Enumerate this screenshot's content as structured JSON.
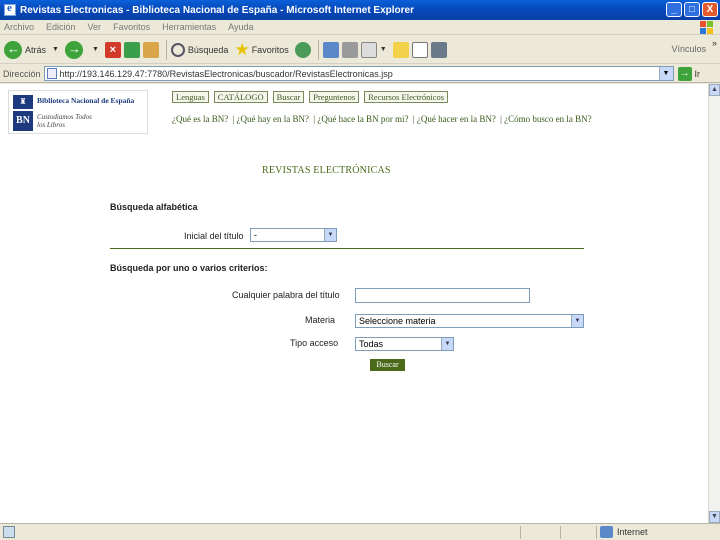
{
  "window": {
    "title": "Revistas Electronicas - Biblioteca Nacional de España - Microsoft Internet Explorer",
    "minimize": "_",
    "maximize": "□",
    "close": "X"
  },
  "menu": [
    "Archivo",
    "Edición",
    "Ver",
    "Favoritos",
    "Herramientas",
    "Ayuda"
  ],
  "toolbar": {
    "back": "Atrás",
    "search": "Búsqueda",
    "favorites": "Favoritos",
    "links": "Vínculos"
  },
  "address": {
    "label": "Dirección",
    "url": "http://193.146.129.47:7780/RevistasElectronicas/buscador/RevistasElectronicas.jsp",
    "go": "Ir"
  },
  "logo": {
    "name": "Biblioteca Nacional de España",
    "abbr": "BN",
    "tagline_1": "Custodiamos Todos",
    "tagline_2": "los Libros"
  },
  "nav": {
    "tabs": [
      "Lenguas",
      "CATÁLOGO",
      "Buscar",
      "Preguntenos",
      "Recursos Electrónicos"
    ],
    "quicklinks": [
      "¿Qué es la BN?",
      "¿Qué hay en la BN?",
      "¿Qué hace la BN por mi?",
      "¿Qué hacer en la BN?",
      "¿Cómo busco en la BN?"
    ]
  },
  "page": {
    "heading": "REVISTAS ELECTRÓNICAS",
    "alpha_section": "Búsqueda alfabética",
    "title_initial_label": "Inicial del título",
    "title_initial_value": "-",
    "criteria_section": "Búsqueda por uno o varios criterios:",
    "any_word_label": "Cualquier palabra del título",
    "any_word_value": "",
    "subject_label": "Materia",
    "subject_value": "Seleccione materia",
    "access_label": "Tipo acceso",
    "access_value": "Todas",
    "search_button": "Buscar"
  },
  "status": {
    "zone": "Internet"
  }
}
